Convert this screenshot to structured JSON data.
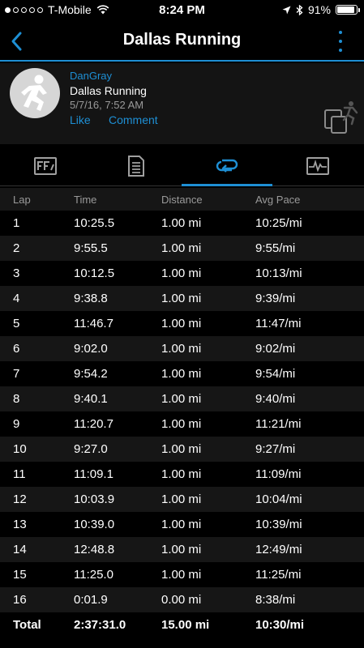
{
  "status_bar": {
    "carrier": "T-Mobile",
    "time": "8:24 PM",
    "battery": "91%",
    "battery_level": 0.91,
    "icons": [
      "signal-dots-icon",
      "wifi-icon",
      "location-arrow-icon",
      "bluetooth-icon",
      "battery-icon"
    ]
  },
  "nav": {
    "title": "Dallas Running",
    "back_icon": "chevron-left-icon",
    "menu_icon": "more-vertical-icon"
  },
  "activity": {
    "user": "DanGray",
    "name": "Dallas Running",
    "date": "5/7/16, 7:52 AM",
    "like": "Like",
    "comment": "Comment",
    "type_icon": "running-activity-icon"
  },
  "tabs": [
    {
      "name": "overview",
      "icon": "overview-card-icon",
      "active": false
    },
    {
      "name": "details",
      "icon": "document-list-icon",
      "active": false
    },
    {
      "name": "laps",
      "icon": "laps-loop-icon",
      "active": true
    },
    {
      "name": "charts",
      "icon": "chart-wave-icon",
      "active": false
    }
  ],
  "table": {
    "headers": {
      "lap": "Lap",
      "time": "Time",
      "distance": "Distance",
      "pace": "Avg Pace"
    },
    "rows": [
      {
        "lap": "1",
        "time": "10:25.5",
        "distance": "1.00 mi",
        "pace": "10:25/mi"
      },
      {
        "lap": "2",
        "time": "9:55.5",
        "distance": "1.00 mi",
        "pace": "9:55/mi"
      },
      {
        "lap": "3",
        "time": "10:12.5",
        "distance": "1.00 mi",
        "pace": "10:13/mi"
      },
      {
        "lap": "4",
        "time": "9:38.8",
        "distance": "1.00 mi",
        "pace": "9:39/mi"
      },
      {
        "lap": "5",
        "time": "11:46.7",
        "distance": "1.00 mi",
        "pace": "11:47/mi"
      },
      {
        "lap": "6",
        "time": "9:02.0",
        "distance": "1.00 mi",
        "pace": "9:02/mi"
      },
      {
        "lap": "7",
        "time": "9:54.2",
        "distance": "1.00 mi",
        "pace": "9:54/mi"
      },
      {
        "lap": "8",
        "time": "9:40.1",
        "distance": "1.00 mi",
        "pace": "9:40/mi"
      },
      {
        "lap": "9",
        "time": "11:20.7",
        "distance": "1.00 mi",
        "pace": "11:21/mi"
      },
      {
        "lap": "10",
        "time": "9:27.0",
        "distance": "1.00 mi",
        "pace": "9:27/mi"
      },
      {
        "lap": "11",
        "time": "11:09.1",
        "distance": "1.00 mi",
        "pace": "11:09/mi"
      },
      {
        "lap": "12",
        "time": "10:03.9",
        "distance": "1.00 mi",
        "pace": "10:04/mi"
      },
      {
        "lap": "13",
        "time": "10:39.0",
        "distance": "1.00 mi",
        "pace": "10:39/mi"
      },
      {
        "lap": "14",
        "time": "12:48.8",
        "distance": "1.00 mi",
        "pace": "12:49/mi"
      },
      {
        "lap": "15",
        "time": "11:25.0",
        "distance": "1.00 mi",
        "pace": "11:25/mi"
      },
      {
        "lap": "16",
        "time": "0:01.9",
        "distance": "0.00 mi",
        "pace": "8:38/mi"
      }
    ],
    "total": {
      "lap": "Total",
      "time": "2:37:31.0",
      "distance": "15.00 mi",
      "pace": "10:30/mi"
    }
  },
  "colors": {
    "accent": "#1e8fd4",
    "background": "#000000",
    "row_alt": "#161616",
    "muted_text": "#9a9a9a"
  }
}
